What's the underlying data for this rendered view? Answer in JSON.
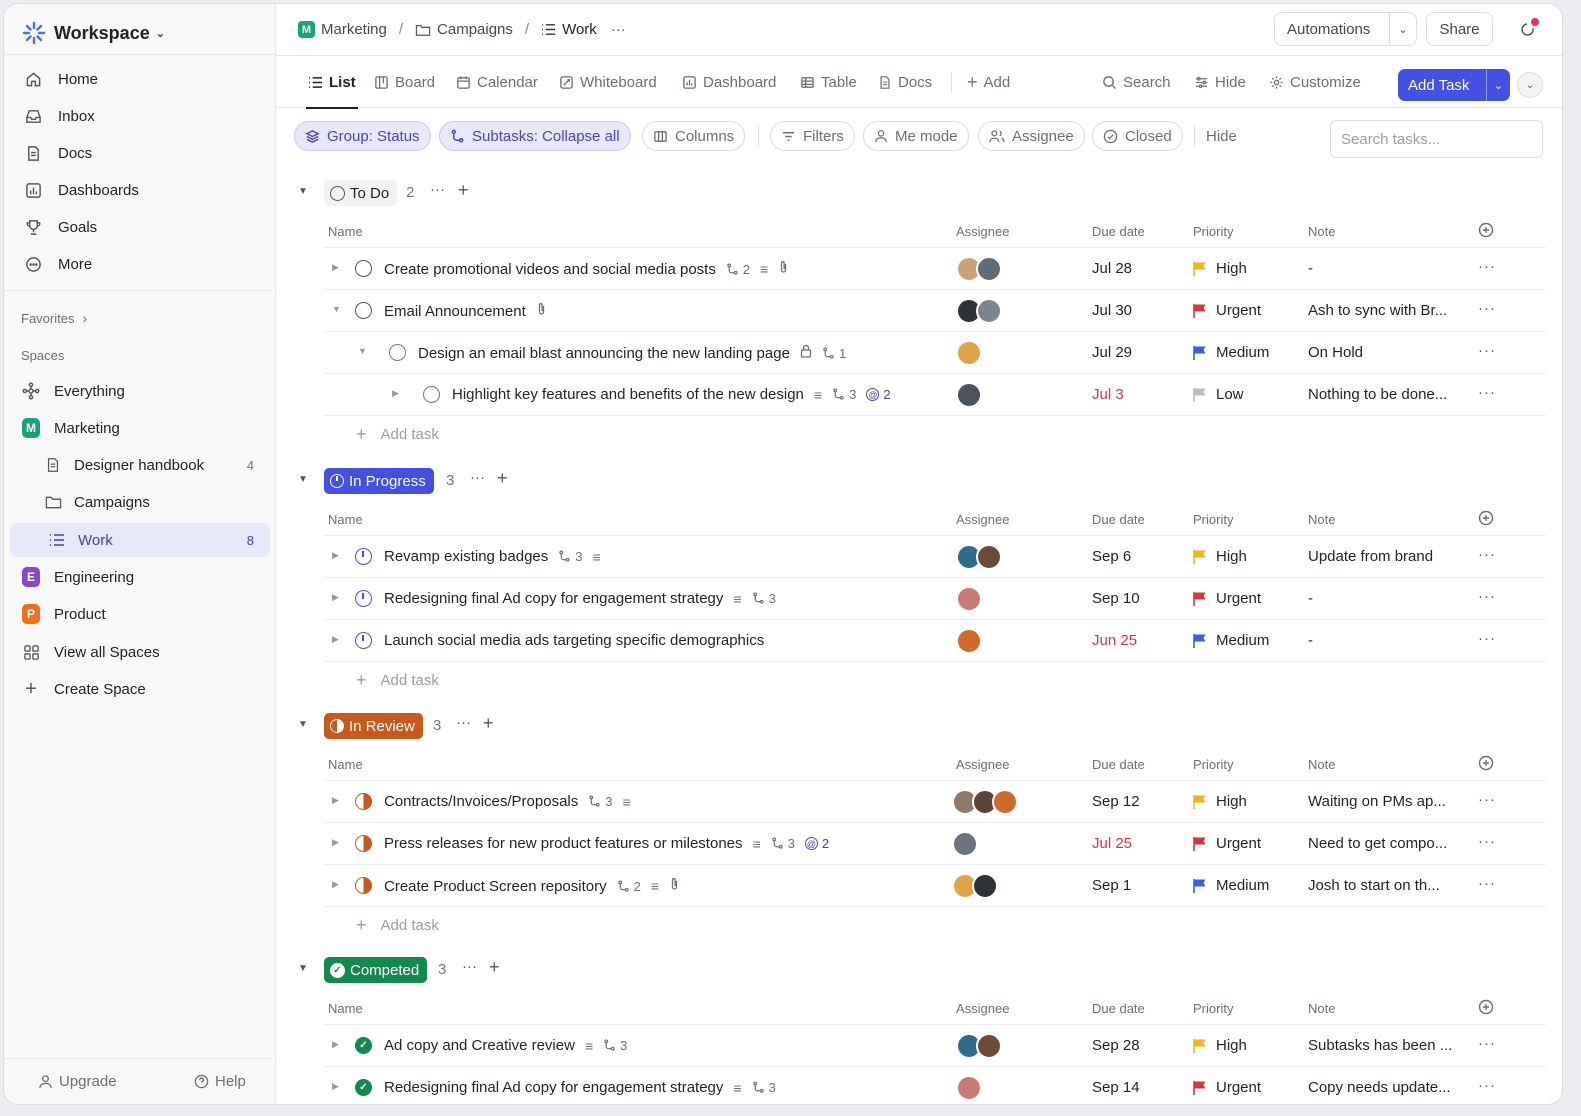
{
  "workspace": {
    "name": "Workspace"
  },
  "nav": [
    {
      "label": "Home",
      "icon": "home-icon"
    },
    {
      "label": "Inbox",
      "icon": "inbox-icon"
    },
    {
      "label": "Docs",
      "icon": "docs-icon"
    },
    {
      "label": "Dashboards",
      "icon": "dashboard-icon"
    },
    {
      "label": "Goals",
      "icon": "trophy-icon"
    },
    {
      "label": "More",
      "icon": "more-icon"
    }
  ],
  "favorites_label": "Favorites",
  "spaces_label": "Spaces",
  "spaces": {
    "everything": "Everything",
    "marketing": {
      "label": "Marketing",
      "letter": "M",
      "color": "#1aa37a"
    },
    "designer_handbook": {
      "label": "Designer handbook",
      "count": "4"
    },
    "campaigns": "Campaigns",
    "work": {
      "label": "Work",
      "count": "8"
    },
    "engineering": {
      "label": "Engineering",
      "letter": "E",
      "color": "#8a45cf"
    },
    "product": {
      "label": "Product",
      "letter": "P",
      "color": "#f07019"
    },
    "view_all": "View all Spaces",
    "create": "Create Space"
  },
  "footer": {
    "upgrade": "Upgrade",
    "help": "Help"
  },
  "breadcrumb": {
    "space": "Marketing",
    "folder": "Campaigns",
    "list": "Work",
    "more": "···",
    "slash": "/"
  },
  "topbar": {
    "automations": "Automations",
    "share": "Share"
  },
  "views": {
    "list": "List",
    "board": "Board",
    "calendar": "Calendar",
    "whiteboard": "Whiteboard",
    "dashboard": "Dashboard",
    "table": "Table",
    "docs": "Docs",
    "add": "Add",
    "search": "Search",
    "hide": "Hide",
    "customize": "Customize",
    "add_task": "Add Task"
  },
  "filters": {
    "group": "Group: Status",
    "subtasks": "Subtasks: Collapse all",
    "columns": "Columns",
    "filters": "Filters",
    "me_mode": "Me mode",
    "assignee": "Assignee",
    "closed": "Closed",
    "hide": "Hide",
    "search_placeholder": "Search tasks..."
  },
  "columns": {
    "name": "Name",
    "assignee": "Assignee",
    "due": "Due date",
    "priority": "Priority",
    "note": "Note"
  },
  "add_task_label": "Add task",
  "colors": {
    "urgent": "#d8343f",
    "high": "#f5b516",
    "medium": "#3c5be8",
    "low": "#b8bcc4",
    "accent": "#4350e3"
  },
  "groups": [
    {
      "label": "To Do",
      "count": "2",
      "style": "todo"
    },
    {
      "label": "In Progress",
      "count": "3",
      "style": "progress",
      "color": "#4350e3"
    },
    {
      "label": "In Review",
      "count": "3",
      "style": "review",
      "color": "#c8581b"
    },
    {
      "label": "Competed",
      "count": "3",
      "style": "done",
      "color": "#128a4d"
    }
  ],
  "tasks": {
    "t1": {
      "name": "Create promotional videos and social media posts",
      "subs": "2",
      "due": "Jul 28",
      "priority": "High",
      "note": "-"
    },
    "t2": {
      "name": "Email Announcement",
      "due": "Jul 30",
      "priority": "Urgent",
      "note": "Ash to sync with Br..."
    },
    "t3": {
      "name": "Design an email blast announcing the new landing page",
      "subs": "1",
      "due": "Jul 29",
      "priority": "Medium",
      "note": "On Hold"
    },
    "t4": {
      "name": "Highlight key features and benefits of the new design",
      "subs": "3",
      "mentions": "2",
      "due": "Jul 3",
      "priority": "Low",
      "note": "Nothing to be done..."
    },
    "p1": {
      "name": "Revamp existing badges",
      "subs": "3",
      "due": "Sep 6",
      "priority": "High",
      "note": "Update from brand"
    },
    "p2": {
      "name": "Redesigning final Ad copy for engagement strategy",
      "subs": "3",
      "due": "Sep 10",
      "priority": "Urgent",
      "note": "-"
    },
    "p3": {
      "name": "Launch social media ads targeting specific demographics",
      "due": "Jun 25",
      "priority": "Medium",
      "note": "-"
    },
    "r1": {
      "name": "Contracts/Invoices/Proposals",
      "subs": "3",
      "due": "Sep 12",
      "priority": "High",
      "note": "Waiting on PMs ap..."
    },
    "r2": {
      "name": "Press releases for new product features or milestones",
      "subs": "3",
      "mentions": "2",
      "due": "Jul 25",
      "priority": "Urgent",
      "note": "Need to get compo..."
    },
    "r3": {
      "name": "Create Product Screen repository",
      "subs": "2",
      "due": "Sep 1",
      "priority": "Medium",
      "note": "Josh to start on th..."
    },
    "c1": {
      "name": "Ad copy and Creative review",
      "subs": "3",
      "due": "Sep 28",
      "priority": "High",
      "note": "Subtasks has been ..."
    },
    "c2": {
      "name": "Redesigning final Ad copy for engagement strategy",
      "subs": "3",
      "due": "Sep 14",
      "priority": "Urgent",
      "note": "Copy needs update..."
    }
  }
}
